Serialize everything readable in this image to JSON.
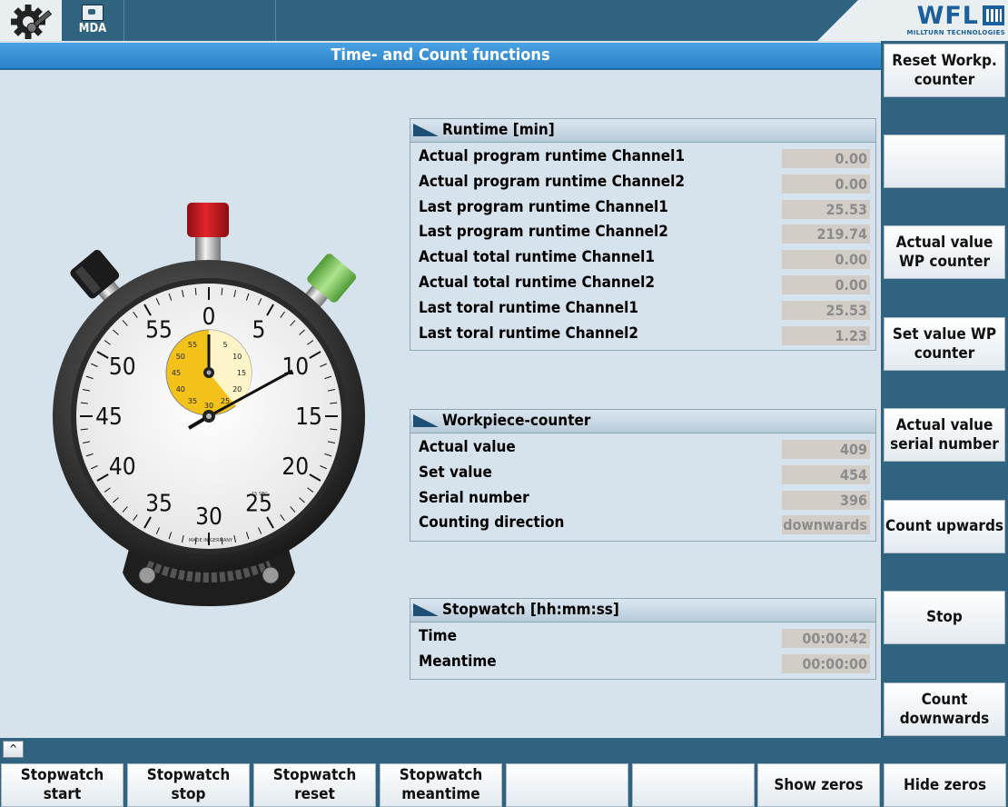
{
  "header": {
    "mda_label": "MDA",
    "logo_text": "WFL",
    "logo_subtitle": "MILLTURN TECHNOLOGIES"
  },
  "title": "Time- and Count functions",
  "runtime": {
    "header": "Runtime [min]",
    "rows": [
      {
        "label": "Actual program runtime Channel1",
        "value": "0.00"
      },
      {
        "label": "Actual program runtime Channel2",
        "value": "0.00"
      },
      {
        "label": "Last program runtime Channel1",
        "value": "25.53"
      },
      {
        "label": "Last program runtime Channel2",
        "value": "219.74"
      },
      {
        "label": "Actual total runtime Channel1",
        "value": "0.00"
      },
      {
        "label": "Actual total runtime Channel2",
        "value": "0.00"
      },
      {
        "label": "Last toral runtime Channel1",
        "value": "25.53"
      },
      {
        "label": "Last toral runtime Channel2",
        "value": "1.23"
      }
    ]
  },
  "workpiece": {
    "header": "Workpiece-counter",
    "rows": [
      {
        "label": "Actual value",
        "value": "409"
      },
      {
        "label": "Set value",
        "value": "454"
      },
      {
        "label": "Serial number",
        "value": "396"
      },
      {
        "label": "Counting direction",
        "value": "downwards"
      }
    ]
  },
  "stopwatch_panel": {
    "header": "Stopwatch [hh:mm:ss]",
    "rows": [
      {
        "label": "Time",
        "value": "00:00:42"
      },
      {
        "label": "Meantime",
        "value": "00:00:00"
      }
    ]
  },
  "right_softkeys": [
    {
      "line1": "Reset Workp.",
      "line2": "counter"
    },
    {
      "line1": "",
      "line2": ""
    },
    {
      "line1": "Actual value",
      "line2": "WP counter"
    },
    {
      "line1": "Set value WP",
      "line2": "counter"
    },
    {
      "line1": "Actual value",
      "line2": "serial number"
    },
    {
      "line1": "Count upwards",
      "line2": ""
    },
    {
      "line1": "Stop",
      "line2": ""
    },
    {
      "line1": "Count",
      "line2": "downwards"
    }
  ],
  "bottom_softkeys": [
    {
      "line1": "Stopwatch",
      "line2": "start"
    },
    {
      "line1": "Stopwatch",
      "line2": "stop"
    },
    {
      "line1": "Stopwatch",
      "line2": "reset"
    },
    {
      "line1": "Stopwatch",
      "line2": "meantime"
    },
    {
      "line1": "",
      "line2": ""
    },
    {
      "line1": "",
      "line2": ""
    },
    {
      "line1": "Show zeros",
      "line2": ""
    },
    {
      "line1": "Hide zeros",
      "line2": ""
    }
  ],
  "stopwatch_image": {
    "dial_numbers": [
      "0",
      "5",
      "10",
      "15",
      "20",
      "25",
      "30",
      "35",
      "40",
      "45",
      "50",
      "55"
    ],
    "subdial_numbers": [
      "55",
      "5",
      "10",
      "15",
      "20",
      "25",
      "30",
      "35",
      "40",
      "45",
      "50"
    ],
    "dial_small_text": "15 SEC",
    "dial_made_in": "MADE IN GERMANY",
    "button_colors": {
      "left": "#1a1a1a",
      "top": "#c4161c",
      "right": "#7bc35a"
    },
    "subdial_color": "#f2c21b"
  }
}
